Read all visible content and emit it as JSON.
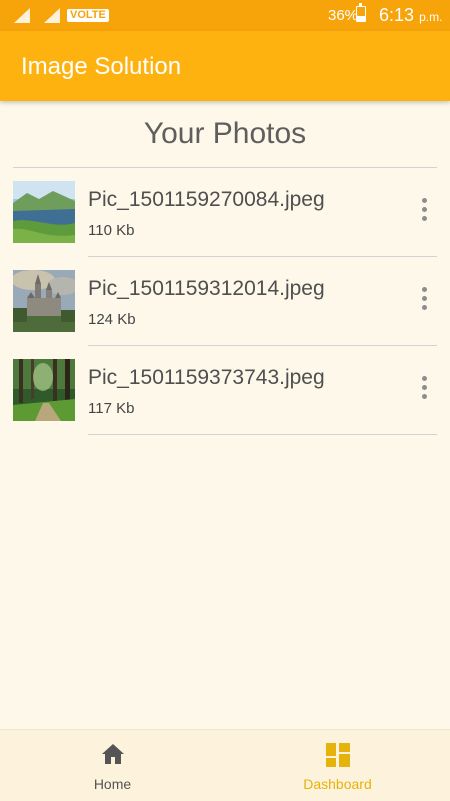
{
  "status_bar": {
    "volte": "VOLTE",
    "battery_percent": "36%",
    "battery_level": 0.36,
    "time": "6:13",
    "ampm": "p.m."
  },
  "app_bar": {
    "title": "Image Solution"
  },
  "main": {
    "heading": "Your Photos",
    "photos": [
      {
        "name": "Pic_1501159270084.jpeg",
        "size": "110 Kb",
        "thumb": "lake-landscape"
      },
      {
        "name": "Pic_1501159312014.jpeg",
        "size": "124 Kb",
        "thumb": "castle"
      },
      {
        "name": "Pic_1501159373743.jpeg",
        "size": "117 Kb",
        "thumb": "forest-path"
      }
    ]
  },
  "bottom_nav": {
    "items": [
      {
        "label": "Home",
        "icon": "home-icon"
      },
      {
        "label": "Dashboard",
        "icon": "dashboard-icon",
        "active": true
      }
    ]
  },
  "colors": {
    "status_bar": "#f7a30a",
    "app_bar": "#fdb20f",
    "background": "#fdf8ea",
    "active_nav": "#e6b20c"
  }
}
